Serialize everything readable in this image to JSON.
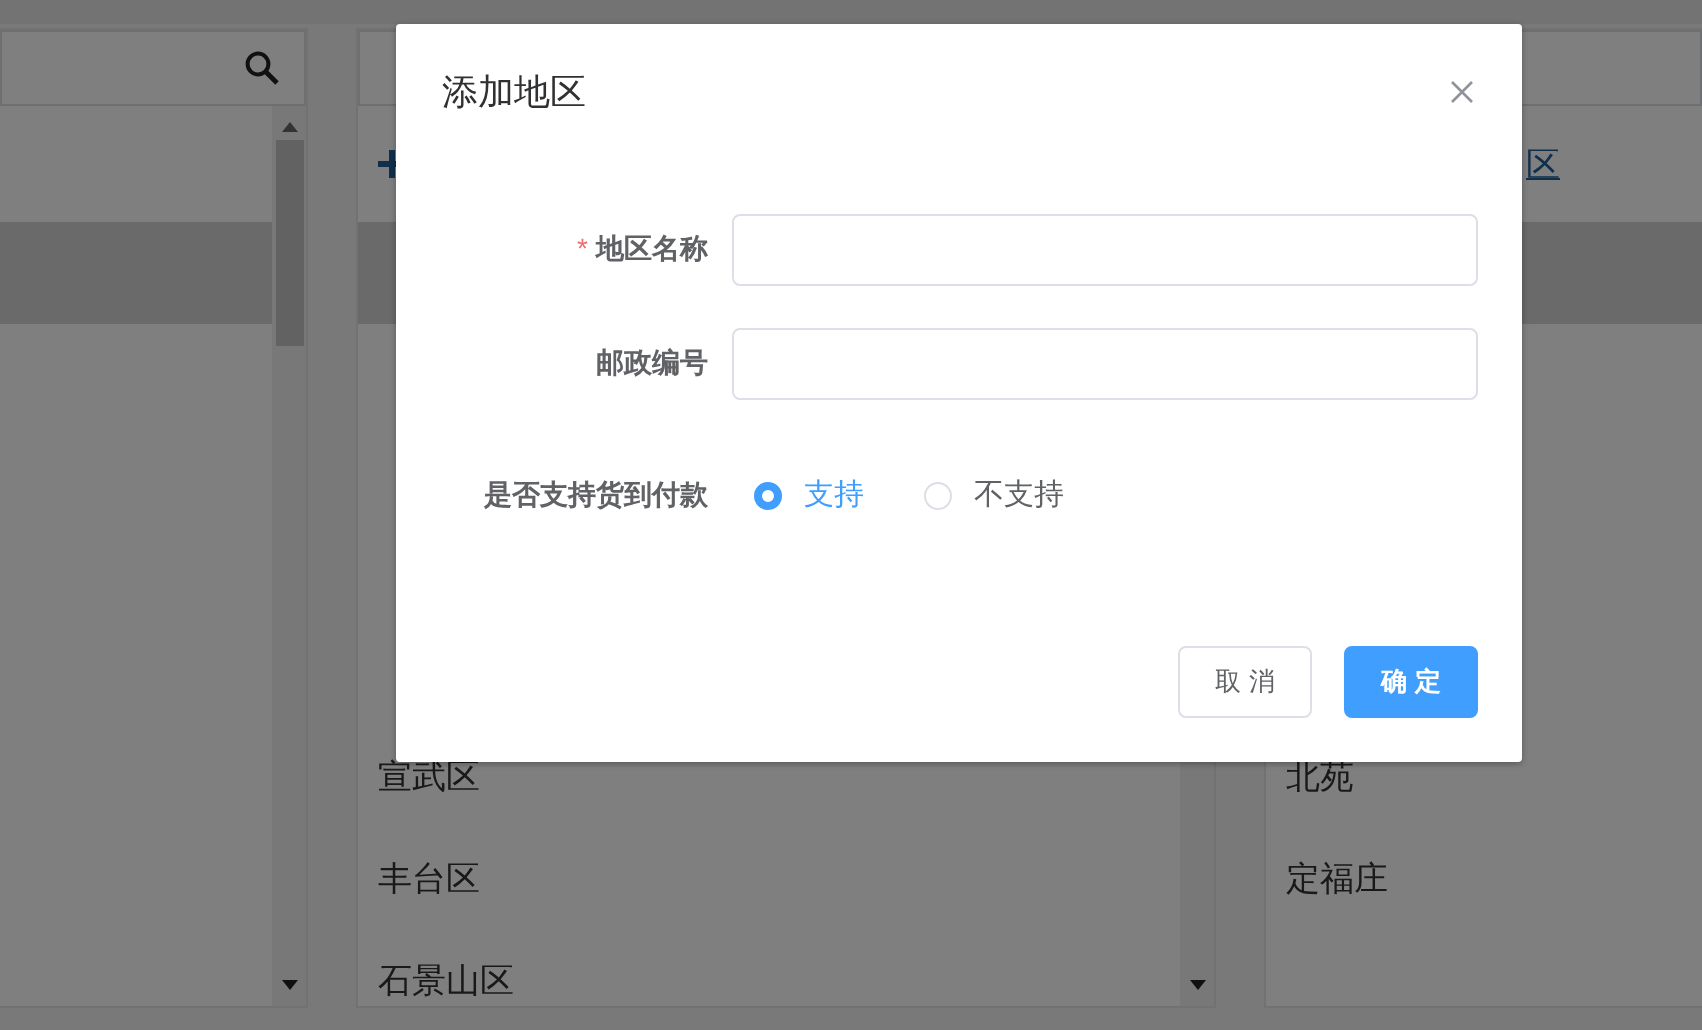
{
  "left_panel": {
    "rows": [
      {
        "selected": true
      }
    ]
  },
  "middle_panel": {
    "link": {
      "kind": "plus"
    },
    "rows": [
      {
        "selected": true
      },
      {
        "text": "宣武区",
        "selected": false
      },
      {
        "text": "丰台区",
        "selected": false
      },
      {
        "text": "石景山区",
        "selected": false
      }
    ]
  },
  "right_panel": {
    "link": {
      "kind": "text",
      "text": "区"
    },
    "rows": [
      {
        "selected": true
      },
      {
        "text": "北苑",
        "selected": false
      },
      {
        "text": "定福庄",
        "selected": false
      }
    ]
  },
  "dialog": {
    "title": "添加地区",
    "fields": [
      {
        "kind": "input",
        "label": "地区名称",
        "required_mark": "*"
      },
      {
        "kind": "input",
        "label": "邮政编号"
      },
      {
        "kind": "radio",
        "label": "是否支持货到付款",
        "options": [
          {
            "label": "支持",
            "selected": true
          },
          {
            "label": "不支持",
            "selected": false
          }
        ]
      }
    ],
    "buttons": [
      {
        "kind": "default",
        "label": "取 消"
      },
      {
        "kind": "primary",
        "label": "确 定"
      }
    ]
  }
}
